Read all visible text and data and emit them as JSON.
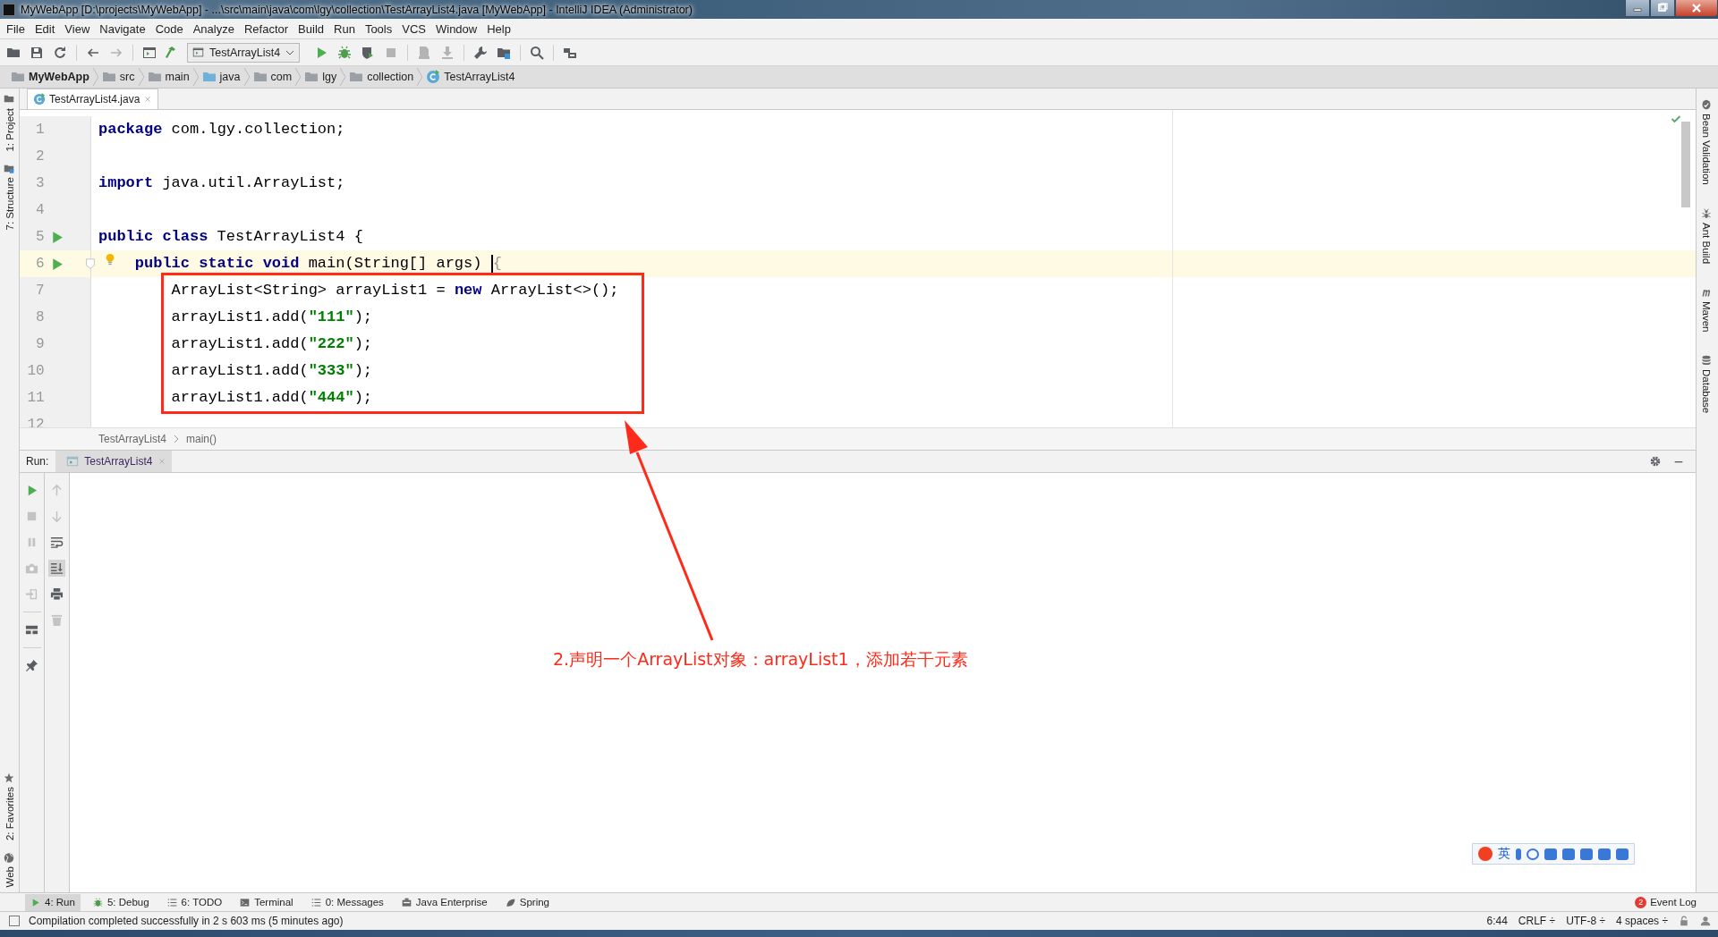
{
  "title_bar": {
    "title": "MyWebApp [D:\\projects\\MyWebApp] - ...\\src\\main\\java\\com\\lgy\\collection\\TestArrayList4.java [MyWebApp] - IntelliJ IDEA (Administrator)"
  },
  "menu": [
    "File",
    "Edit",
    "View",
    "Navigate",
    "Code",
    "Analyze",
    "Refactor",
    "Build",
    "Run",
    "Tools",
    "VCS",
    "Window",
    "Help"
  ],
  "toolbar": [
    {
      "kind": "folder",
      "disabled": false
    },
    {
      "kind": "save",
      "disabled": false
    },
    {
      "kind": "sync",
      "disabled": false
    },
    {
      "kind": "separator"
    },
    {
      "kind": "back",
      "disabled": false
    },
    {
      "kind": "forward",
      "disabled": true
    },
    {
      "kind": "separator"
    },
    {
      "kind": "window",
      "disabled": false
    },
    {
      "kind": "hammer",
      "disabled": false
    },
    {
      "kind": "config",
      "label": "TestArrayList4",
      "disabled": false
    },
    {
      "kind": "play",
      "disabled": false
    },
    {
      "kind": "bug",
      "disabled": false
    },
    {
      "kind": "coverage",
      "disabled": false
    },
    {
      "kind": "stop",
      "disabled": true
    },
    {
      "kind": "separator"
    },
    {
      "kind": "document",
      "disabled": true
    },
    {
      "kind": "download",
      "disabled": true
    },
    {
      "kind": "separator"
    },
    {
      "kind": "wrench",
      "disabled": false
    },
    {
      "kind": "structure",
      "disabled": false
    },
    {
      "kind": "separator"
    },
    {
      "kind": "search",
      "disabled": false
    },
    {
      "kind": "separator"
    },
    {
      "kind": "plugin",
      "disabled": false
    }
  ],
  "navigation_bar": [
    {
      "kind": "project",
      "label": "MyWebApp"
    },
    {
      "kind": "folder",
      "label": "src"
    },
    {
      "kind": "folder",
      "label": "main"
    },
    {
      "kind": "source",
      "label": "java"
    },
    {
      "kind": "folder",
      "label": "com"
    },
    {
      "kind": "folder",
      "label": "lgy"
    },
    {
      "kind": "folder",
      "label": "collection"
    },
    {
      "kind": "class",
      "label": "TestArrayList4"
    }
  ],
  "left_stripe": {
    "top": [
      {
        "kind": "project",
        "label": "1: Project"
      },
      {
        "kind": "structure",
        "label": "7: Structure"
      }
    ],
    "bottom": [
      {
        "kind": "star",
        "label": "2: Favorites"
      },
      {
        "kind": "globe",
        "label": "Web"
      }
    ]
  },
  "right_stripe": [
    {
      "kind": "bean",
      "label": "Bean Validation"
    },
    {
      "kind": "ant",
      "label": "Ant Build"
    },
    {
      "kind": "maven",
      "label": "Maven"
    },
    {
      "kind": "database",
      "label": "Database"
    }
  ],
  "editor_tabs": [
    {
      "label": "TestArrayList4.java",
      "selected": true
    }
  ],
  "editor": {
    "lines": [
      {
        "number": "1",
        "run_marker": false,
        "current": false,
        "tokens": [
          {
            "kind": "keyword",
            "text": "package"
          },
          {
            "kind": "plain",
            "text": " com.lgy.collection;"
          }
        ]
      },
      {
        "number": "2",
        "run_marker": false,
        "current": false
      },
      {
        "number": "3",
        "run_marker": false,
        "current": false,
        "tokens": [
          {
            "kind": "keyword",
            "text": "import"
          },
          {
            "kind": "plain",
            "text": " java.util.ArrayList;"
          }
        ]
      },
      {
        "number": "4",
        "run_marker": false,
        "current": false
      },
      {
        "number": "5",
        "run_marker": true,
        "current": false,
        "tokens": [
          {
            "kind": "keyword",
            "text": "public class"
          },
          {
            "kind": "plain",
            "text": " TestArrayList4 {"
          }
        ]
      },
      {
        "number": "6",
        "run_marker": true,
        "current": true,
        "fold": true,
        "bulb": true,
        "tokens": [
          {
            "kind": "keyword",
            "text": "    public static void"
          },
          {
            "kind": "plain",
            "text": " main(String[] args) "
          },
          {
            "kind": "caret"
          },
          {
            "kind": "brace",
            "text": "{"
          }
        ]
      },
      {
        "number": "7",
        "run_marker": false,
        "current": false,
        "tokens": [
          {
            "kind": "plain",
            "text": "        ArrayList<String> arrayList1 = "
          },
          {
            "kind": "keyword",
            "text": "new"
          },
          {
            "kind": "plain",
            "text": " ArrayList<>();"
          }
        ]
      },
      {
        "number": "8",
        "run_marker": false,
        "current": false,
        "tokens": [
          {
            "kind": "plain",
            "text": "        arrayList1.add("
          },
          {
            "kind": "string",
            "text": "\"111\""
          },
          {
            "kind": "plain",
            "text": ");"
          }
        ]
      },
      {
        "number": "9",
        "run_marker": false,
        "current": false,
        "tokens": [
          {
            "kind": "plain",
            "text": "        arrayList1.add("
          },
          {
            "kind": "string",
            "text": "\"222\""
          },
          {
            "kind": "plain",
            "text": ");"
          }
        ]
      },
      {
        "number": "10",
        "run_marker": false,
        "current": false,
        "tokens": [
          {
            "kind": "plain",
            "text": "        arrayList1.add("
          },
          {
            "kind": "string",
            "text": "\"333\""
          },
          {
            "kind": "plain",
            "text": ");"
          }
        ]
      },
      {
        "number": "11",
        "run_marker": false,
        "current": false,
        "tokens": [
          {
            "kind": "plain",
            "text": "        arrayList1.add("
          },
          {
            "kind": "string",
            "text": "\"444\""
          },
          {
            "kind": "plain",
            "text": ");"
          }
        ]
      },
      {
        "number": "12",
        "run_marker": false,
        "current": false
      }
    ],
    "breadcrumb": [
      "TestArrayList4",
      "main()"
    ]
  },
  "run_panel": {
    "label": "Run:",
    "tabs": [
      {
        "label": "TestArrayList4",
        "selected": true
      }
    ],
    "tools_left": [
      {
        "kind": "play",
        "disabled": false
      },
      {
        "kind": "stop",
        "disabled": true
      },
      {
        "kind": "pause",
        "disabled": true
      },
      {
        "kind": "camera",
        "disabled": true
      },
      {
        "kind": "enter",
        "disabled": true
      },
      {
        "kind": "separator"
      },
      {
        "kind": "layout",
        "disabled": false
      },
      {
        "kind": "separator"
      },
      {
        "kind": "pin",
        "disabled": false
      }
    ],
    "tools_right": [
      {
        "kind": "up",
        "disabled": true,
        "on": false
      },
      {
        "kind": "down",
        "disabled": true,
        "on": false
      },
      {
        "kind": "wrap",
        "disabled": false,
        "on": false
      },
      {
        "kind": "scroll",
        "disabled": false,
        "on": true
      },
      {
        "kind": "print",
        "disabled": false,
        "on": false
      },
      {
        "kind": "trash",
        "disabled": true,
        "on": false
      }
    ]
  },
  "tool_windows_bar": [
    {
      "kind": "play",
      "label": "4: Run",
      "selected": true
    },
    {
      "kind": "bug",
      "label": "5: Debug",
      "selected": false
    },
    {
      "kind": "list",
      "label": "6: TODO",
      "selected": false
    },
    {
      "kind": "terminal",
      "label": "Terminal",
      "selected": false
    },
    {
      "kind": "list",
      "label": "0: Messages",
      "selected": false
    },
    {
      "kind": "enterprise",
      "label": "Java Enterprise",
      "selected": false
    },
    {
      "kind": "leaf",
      "label": "Spring",
      "selected": false
    }
  ],
  "event_log": {
    "count": "2",
    "label": "Event Log"
  },
  "status_bar": {
    "message": "Compilation completed successfully in 2 s 603 ms (5 minutes ago)",
    "widgets": [
      "6:44",
      "CRLF ÷",
      "UTF-8 ÷",
      "4 spaces ÷"
    ]
  },
  "annotation": {
    "text": "2.声明一个ArrayList对象：arrayList1，添加若干元素"
  },
  "ime_toolbar": {
    "mode": "英"
  }
}
